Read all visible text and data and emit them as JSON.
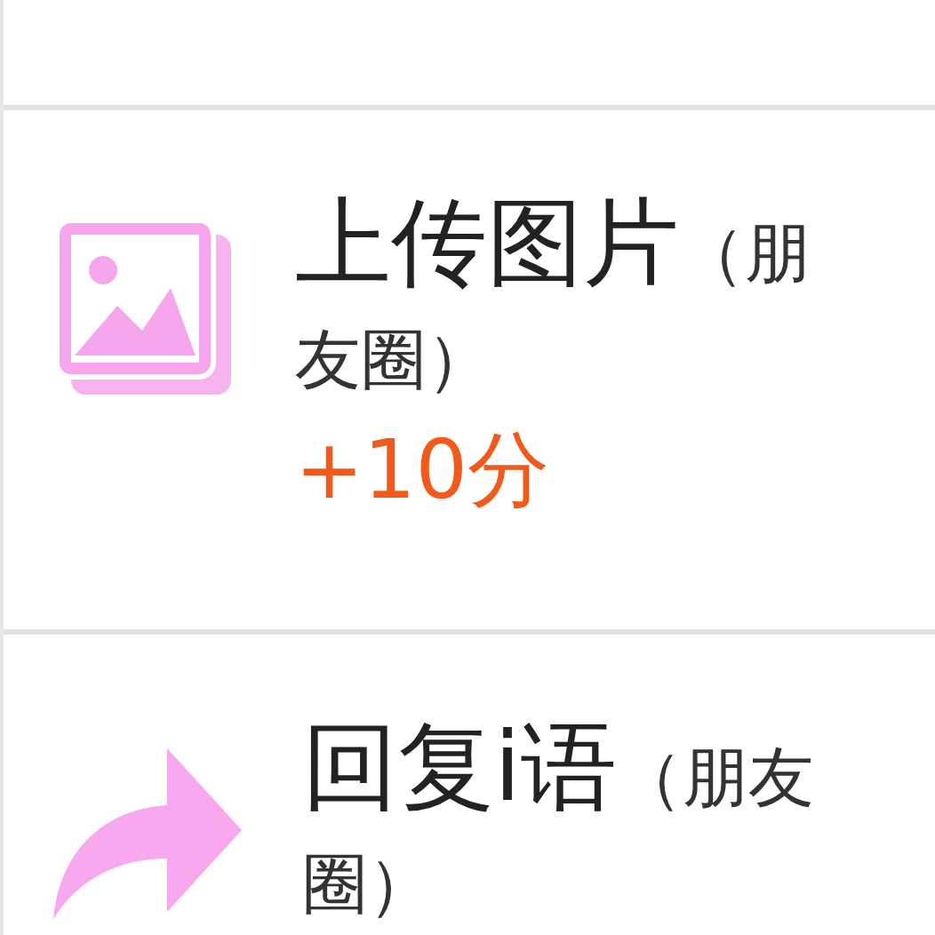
{
  "tasks": [
    {
      "kind": "image",
      "title": "上传图片",
      "note": "（朋友圈）",
      "points": "+10分"
    },
    {
      "kind": "reply",
      "title": "回复i语",
      "note": "（朋友圈）"
    }
  ]
}
